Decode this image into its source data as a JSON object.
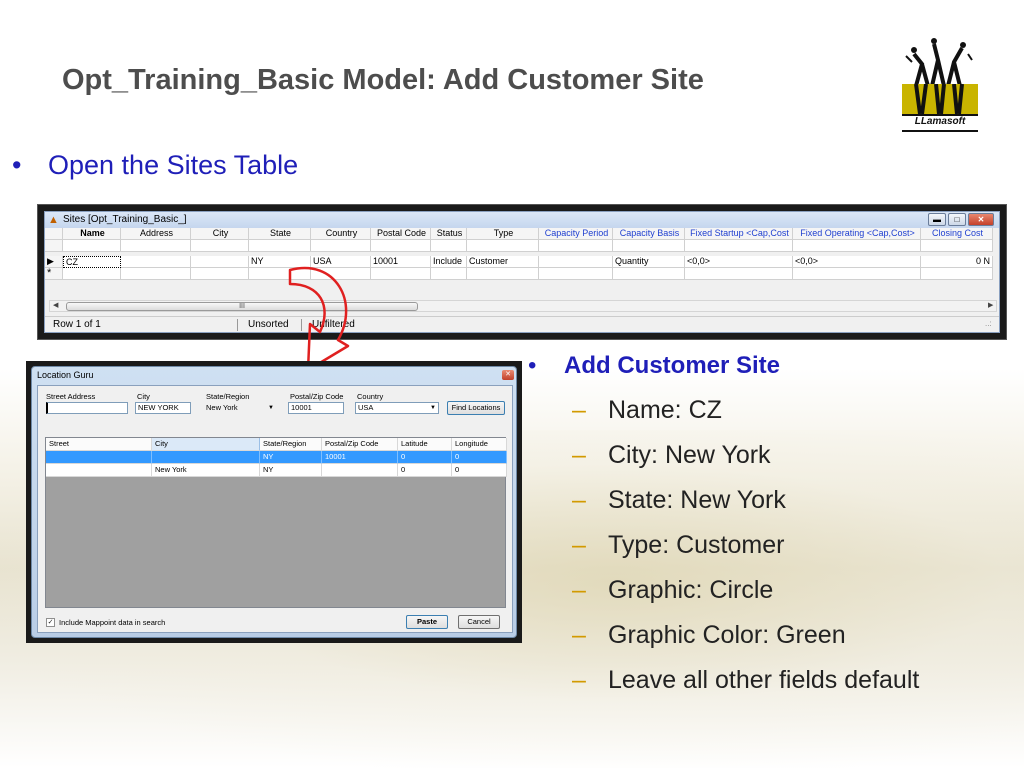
{
  "slide": {
    "title": "Opt_Training_Basic Model: Add Customer Site",
    "bullet1": "Open the Sites Table",
    "logo_text": "LLamasoft"
  },
  "sites_window": {
    "title": "Sites [Opt_Training_Basic_]",
    "columns": [
      "Name",
      "Address",
      "City",
      "State",
      "Country",
      "Postal Code",
      "Status",
      "Type",
      "Capacity Period",
      "Capacity Basis",
      "Fixed Startup <Cap,Cost",
      "Fixed Operating <Cap,Cost>",
      "Closing Cost"
    ],
    "row": [
      "CZ",
      "",
      "",
      "NY",
      "USA",
      "10001",
      "Include",
      "Customer",
      "",
      "Quantity",
      "<0,0>",
      "<0,0>",
      "0 N"
    ],
    "new_row_marker": "*",
    "current_row_marker": "▶",
    "scroll_thumb": "III",
    "status": {
      "record": "Row 1 of 1",
      "sort": "Unsorted",
      "filter": "Unfiltered",
      "grip": "..:"
    }
  },
  "location_guru": {
    "title": "Location Guru",
    "labels": {
      "street": "Street Address",
      "city": "City",
      "state": "State/Region",
      "postal": "Postal/Zip Code",
      "country": "Country"
    },
    "fields": {
      "street": "",
      "city": "NEW YORK",
      "state": "New York",
      "postal": "10001",
      "country": "USA"
    },
    "find_button": "Find Locations",
    "columns": [
      "Street",
      "City",
      "State/Region",
      "Postal/Zip Code",
      "Latitude",
      "Longitude"
    ],
    "rows": [
      [
        "",
        "",
        "NY",
        "10001",
        "0",
        "0"
      ],
      [
        "",
        "New York",
        "NY",
        "",
        "0",
        "0"
      ]
    ],
    "include_mappoint": "Include Mappoint data in search",
    "include_checked": true,
    "paste_button": "Paste",
    "cancel_button": "Cancel"
  },
  "right_bullets": {
    "heading": "Add Customer Site",
    "items": [
      "Name: CZ",
      "City: New York",
      "State: New York",
      "Type: Customer",
      "Graphic: Circle",
      "Graphic Color: Green",
      "Leave all other fields default"
    ]
  },
  "colors": {
    "title_gray": "#4d4d4d",
    "bullet_blue": "#1f1fb8",
    "dash_gold": "#d29a00",
    "arrow_red": "#e02020",
    "selection_blue": "#3399ff",
    "logo_gold": "#c9b400"
  }
}
